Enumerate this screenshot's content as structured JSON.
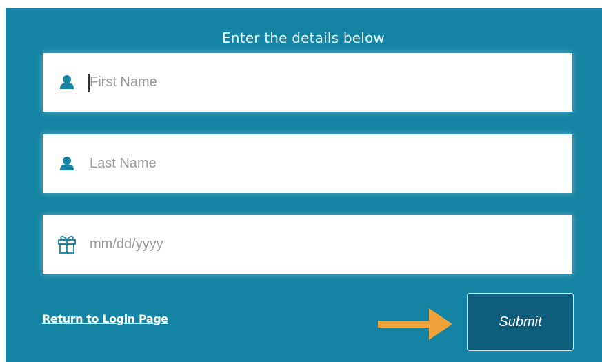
{
  "form": {
    "heading": "Enter the details below",
    "fields": [
      {
        "icon": "user-icon",
        "placeholder": "First Name",
        "value": ""
      },
      {
        "icon": "user-icon",
        "placeholder": "Last Name",
        "value": ""
      },
      {
        "icon": "gift-icon",
        "placeholder": "mm/dd/yyyy",
        "value": ""
      }
    ],
    "return_link": "Return to Login Page",
    "submit_label": "Submit",
    "annotation_icon": "arrow-right-icon"
  },
  "colors": {
    "panel_bg": "#1583a4",
    "icon_color": "#1583a4",
    "submit_bg": "#0f5d7c",
    "annotation_arrow": "#f0a23a"
  }
}
